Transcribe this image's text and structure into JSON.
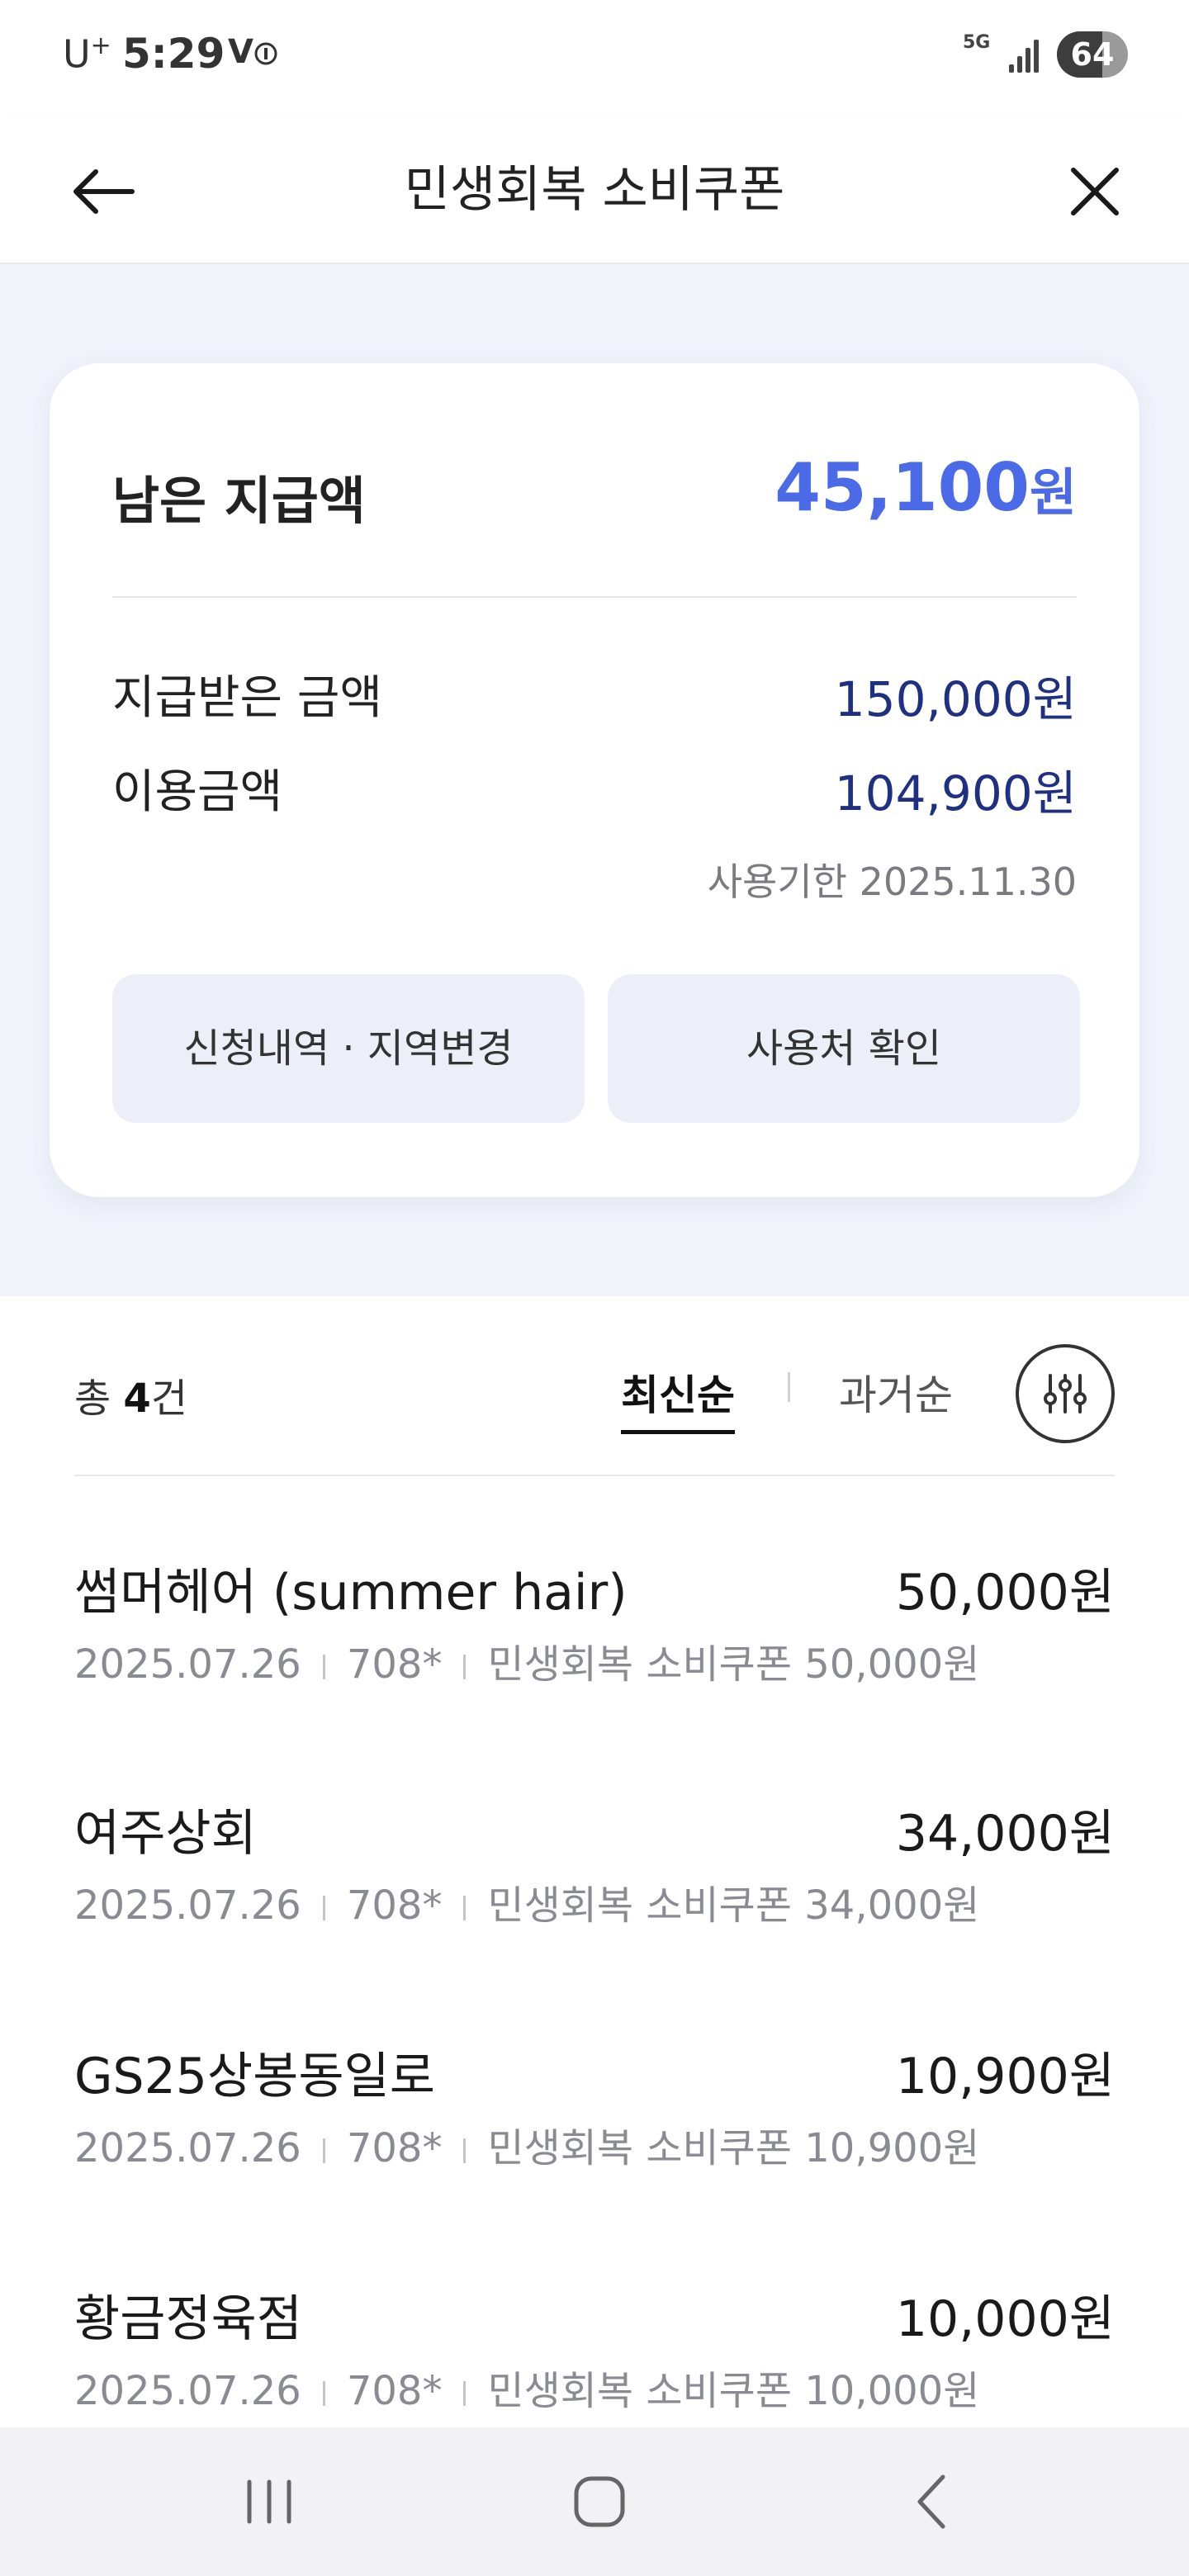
{
  "status_bar": {
    "carrier": "U",
    "carrier_sup": "+",
    "time": "5:29",
    "volte": "V",
    "network": "5G",
    "battery": "64"
  },
  "header": {
    "title": "민생회복 소비쿠폰",
    "back_icon": "arrow-left-icon",
    "close_icon": "close-icon"
  },
  "summary": {
    "remaining_label": "남은 지급액",
    "remaining_amount": "45,100",
    "remaining_unit": "원",
    "received_label": "지급받은 금액",
    "received_value": "150,000원",
    "used_label": "이용금액",
    "used_value": "104,900원",
    "expiry": "사용기한 2025.11.30",
    "btn_history": "신청내역 · 지역변경",
    "btn_places": "사용처 확인"
  },
  "list": {
    "total_prefix": "총 ",
    "total_count": "4",
    "total_suffix": "건",
    "sort_latest": "최신순",
    "sort_oldest": "과거순",
    "filter_icon": "sliders-icon",
    "items": [
      {
        "name": "썸머헤어 (summer hair)",
        "amount": "50,000원",
        "date": "2025.07.26",
        "card": "708*",
        "desc": "민생회복 소비쿠폰 50,000원"
      },
      {
        "name": "여주상회",
        "amount": "34,000원",
        "date": "2025.07.26",
        "card": "708*",
        "desc": "민생회복 소비쿠폰 34,000원"
      },
      {
        "name": "GS25상봉동일로",
        "amount": "10,900원",
        "date": "2025.07.26",
        "card": "708*",
        "desc": "민생회복 소비쿠폰 10,900원"
      },
      {
        "name": "황금정육점",
        "amount": "10,000원",
        "date": "2025.07.26",
        "card": "708*",
        "desc": "민생회복 소비쿠폰 10,000원"
      }
    ]
  },
  "colors": {
    "accent": "#4a6ae8",
    "value_navy": "#1f2f82",
    "summary_bg": "#f0f3fa",
    "button_bg": "#eceff7"
  }
}
